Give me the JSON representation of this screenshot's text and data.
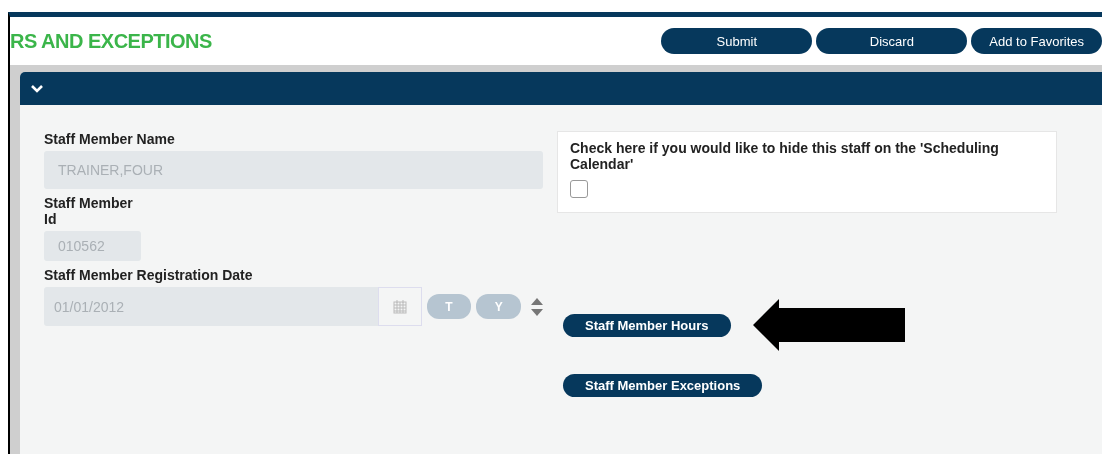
{
  "page": {
    "title": "RS AND EXCEPTIONS"
  },
  "actions": [
    "Submit",
    "Discard",
    "Add to Favorites"
  ],
  "panel": {
    "expanded": true
  },
  "fields": [
    {
      "kind": "text",
      "label": "Staff Member Name",
      "value": "TRAINER,FOUR",
      "disabled": true
    },
    {
      "kind": "short",
      "label": "Staff Member Id",
      "value": "010562",
      "disabled": true
    },
    {
      "kind": "date",
      "label": "Staff Member Registration Date",
      "value": "01/01/2012",
      "disabled": true,
      "shortcuts": [
        "T",
        "Y"
      ]
    }
  ],
  "hide_option": {
    "label": "Check here if you would like to hide this staff on the 'Scheduling Calendar'",
    "checked": false
  },
  "links": [
    "Staff Member Hours",
    "Staff Member Exceptions"
  ]
}
